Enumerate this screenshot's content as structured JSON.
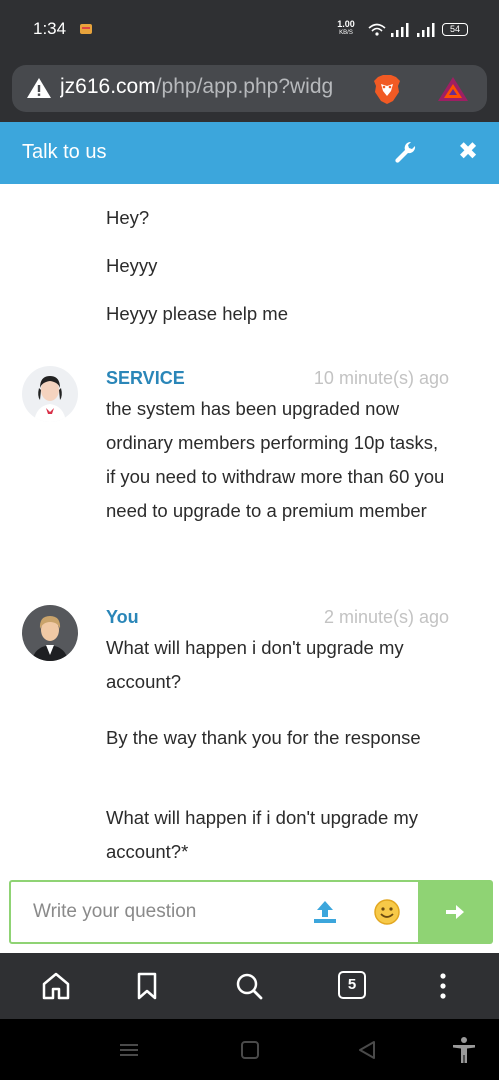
{
  "status_bar": {
    "time": "1:34",
    "speed_value": "1.00",
    "speed_unit": "KB/S",
    "battery": "54"
  },
  "browser": {
    "url_host": "jz616.com",
    "url_path": "/php/app.php?widg",
    "tab_count": "5"
  },
  "chat": {
    "title": "Talk to us",
    "messages_user_first": [
      "Hey?",
      "Heyyy",
      "Heyyy please help me"
    ],
    "service": {
      "sender": "SERVICE",
      "time": "10 minute(s) ago",
      "text": "the system has been upgraded now ordinary members performing 10p tasks, if you need to withdraw more than 60 you need to upgrade to a premium member"
    },
    "you": {
      "sender": "You",
      "time": "2 minute(s) ago",
      "messages": [
        "What will happen i don't upgrade my account?",
        "By the way thank you for the response",
        "What will happen if i don't upgrade my account?*"
      ]
    }
  },
  "composer": {
    "placeholder": "Write your question"
  },
  "colors": {
    "header": "#3ca6dc",
    "sender": "#2a86b8",
    "send": "#8fd374"
  }
}
